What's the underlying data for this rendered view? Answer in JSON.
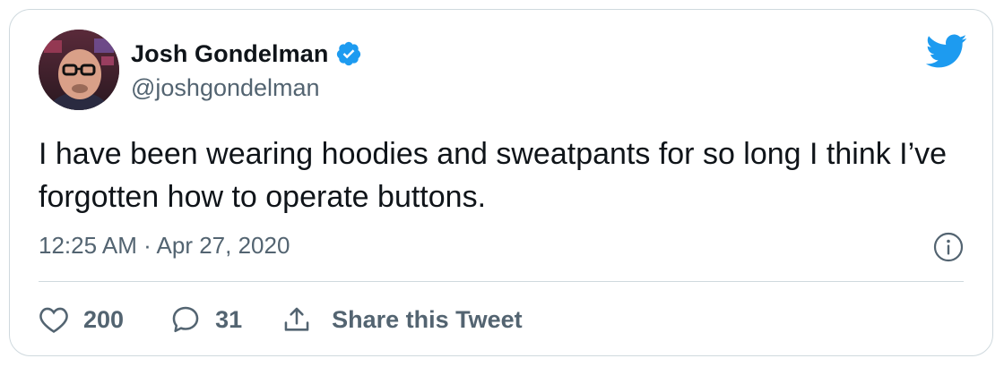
{
  "author": {
    "display_name": "Josh Gondelman",
    "handle": "@joshgondelman",
    "verified": true,
    "avatar_icon": "profile-photo"
  },
  "tweet": {
    "text": "I have been wearing hoodies and sweatpants for so long I think I’ve forgotten how to operate buttons.",
    "timestamp": "12:25 AM · Apr 27, 2020"
  },
  "actions": {
    "likes": "200",
    "replies": "31",
    "share_label": "Share this Tweet"
  },
  "icons": {
    "brand": "twitter-bird-icon",
    "verified": "verified-badge-icon",
    "info": "info-icon",
    "like": "heart-icon",
    "reply": "reply-bubble-icon",
    "share": "share-icon"
  },
  "colors": {
    "brand_blue": "#1d9bf0",
    "text_primary": "#0f1419",
    "text_secondary": "#536471",
    "border": "#cfd9de"
  }
}
